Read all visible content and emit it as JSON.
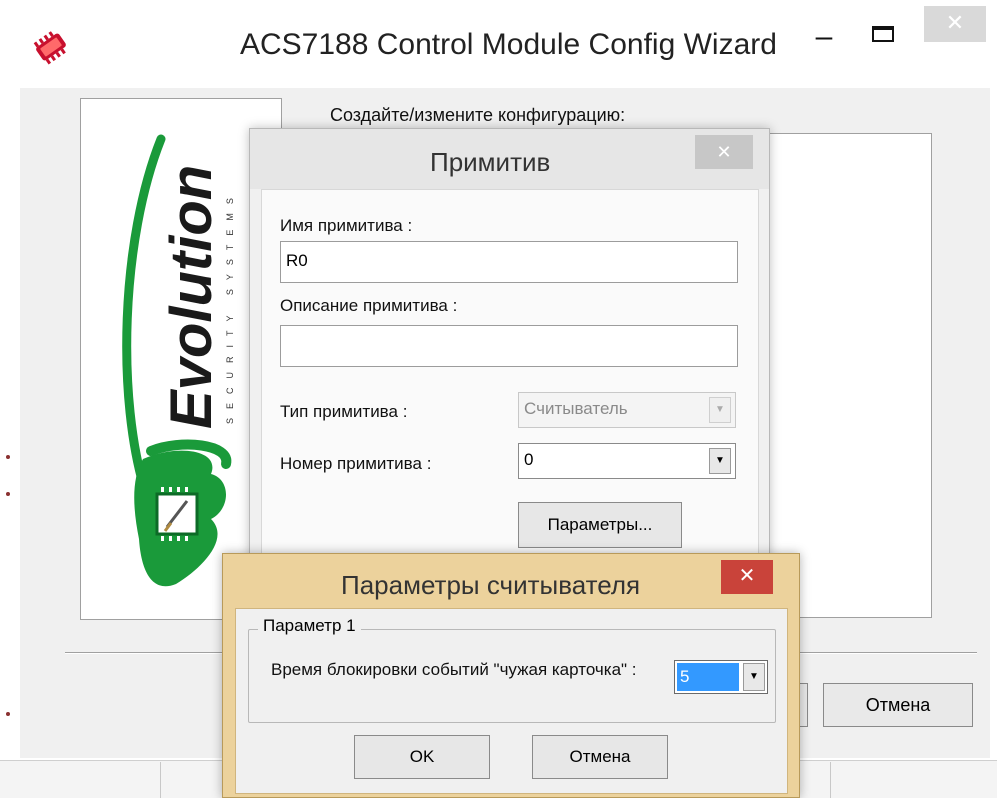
{
  "main_window": {
    "title": "ACS7188 Control Module Config Wizard",
    "minimize_glyph": "–",
    "close_glyph": "✕",
    "create_label": "Создайте/измените  конфигурацию:",
    "cancel_label": "Отмена",
    "logo": {
      "text": "Evolution",
      "tagline": "SECURITY SYSTEMS",
      "green": "#1a9a3a"
    }
  },
  "primitive_dialog": {
    "title": "Примитив",
    "close_glyph": "✕",
    "name_label": "Имя примитива :",
    "name_value": "R0",
    "description_label": "Описание примитива :",
    "description_value": "",
    "type_label": "Тип примитива :",
    "type_value": "Считыватель",
    "number_label": "Номер примитива :",
    "number_value": "0",
    "params_button": "Параметры..."
  },
  "reader_params_dialog": {
    "title": "Параметры считывателя",
    "close_glyph": "✕",
    "group_title": "Параметр 1",
    "param_label": "Время блокировки событий \"чужая карточка\" :",
    "param_value": "5",
    "ok_label": "OK",
    "cancel_label": "Отмена",
    "frame_color": "#ecd29c",
    "close_color": "#c9433a"
  }
}
